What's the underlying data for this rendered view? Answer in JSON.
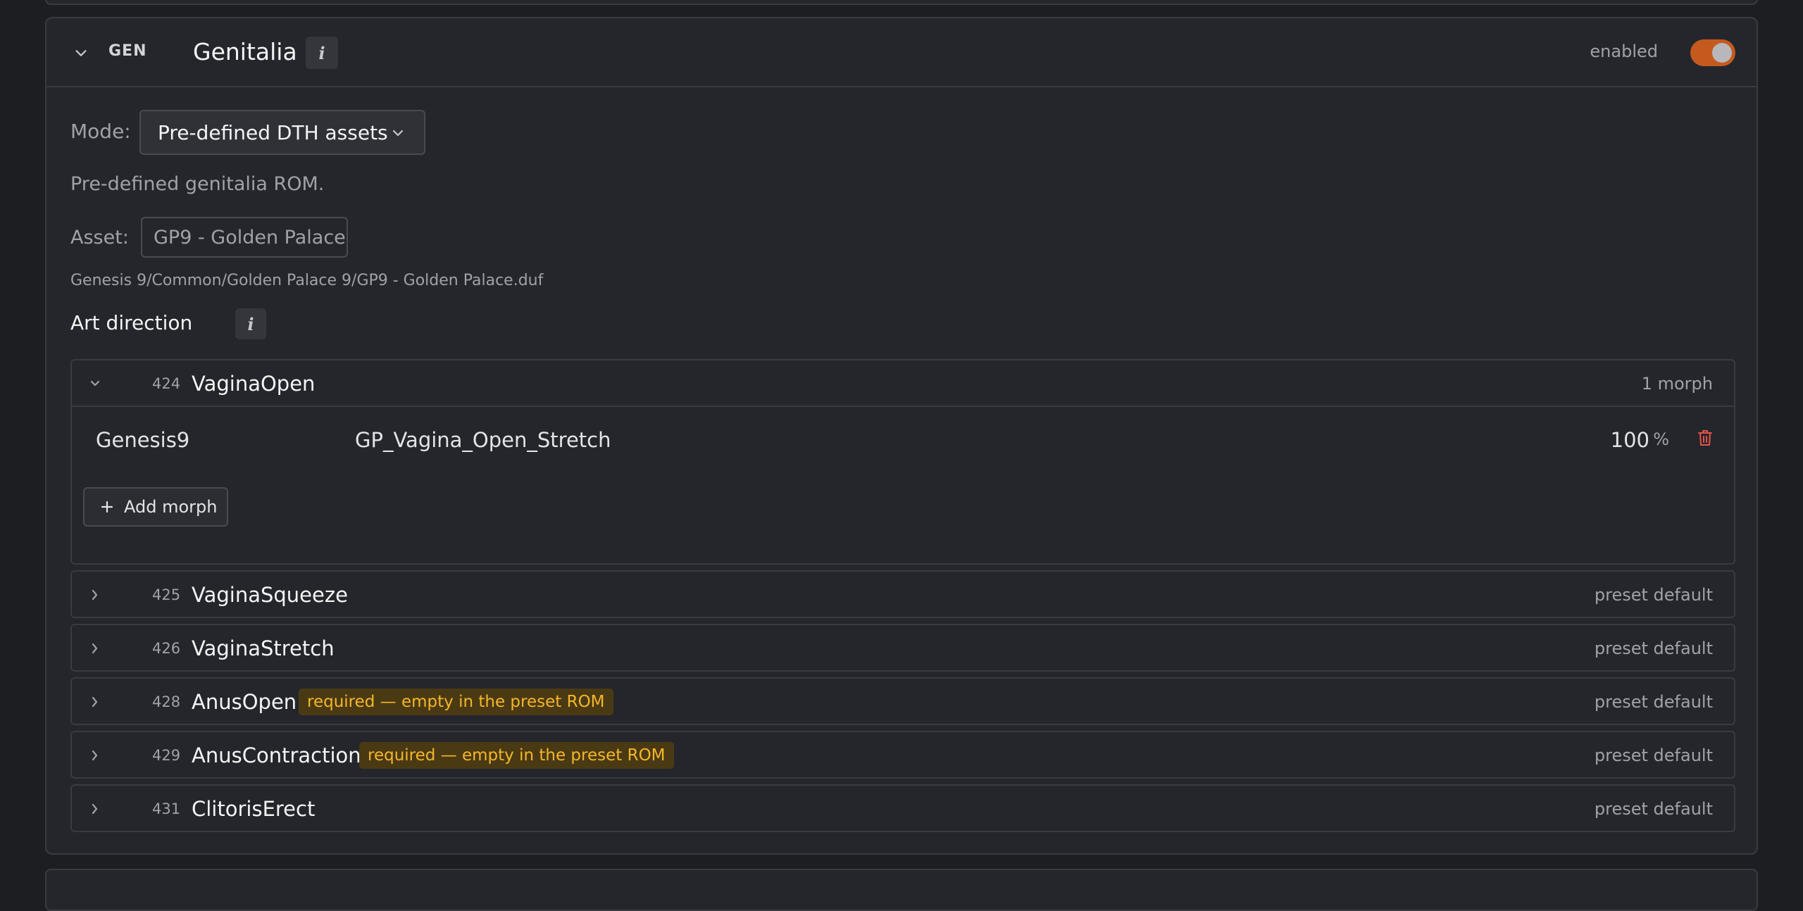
{
  "section": {
    "code": "GEN",
    "title": "Genitalia",
    "enabled_label": "enabled",
    "enabled": true,
    "accent_color": "#c45a1e"
  },
  "mode": {
    "label": "Mode:",
    "value": "Pre-defined DTH assets"
  },
  "description": "Pre-defined genitalia ROM.",
  "asset": {
    "label": "Asset:",
    "value": "GP9 - Golden Palace",
    "path": "Genesis 9/Common/Golden Palace 9/GP9 - Golden Palace.duf"
  },
  "art_direction": {
    "title": "Art direction",
    "expanded": {
      "num": "424",
      "name": "VaginaOpen",
      "count": "1 morph",
      "morphs": [
        {
          "figure": "Genesis9",
          "name": "GP_Vagina_Open_Stretch",
          "value": "100",
          "unit": "%"
        }
      ],
      "add_label": "Add morph"
    },
    "rows": [
      {
        "num": "425",
        "name": "VaginaSqueeze",
        "status": "preset default",
        "badge": ""
      },
      {
        "num": "426",
        "name": "VaginaStretch",
        "status": "preset default",
        "badge": ""
      },
      {
        "num": "428",
        "name": "AnusOpen",
        "status": "preset default",
        "badge": "required — empty in the preset ROM"
      },
      {
        "num": "429",
        "name": "AnusContraction",
        "status": "preset default",
        "badge": "required — empty in the preset ROM"
      },
      {
        "num": "431",
        "name": "ClitorisErect",
        "status": "preset default",
        "badge": ""
      }
    ]
  }
}
